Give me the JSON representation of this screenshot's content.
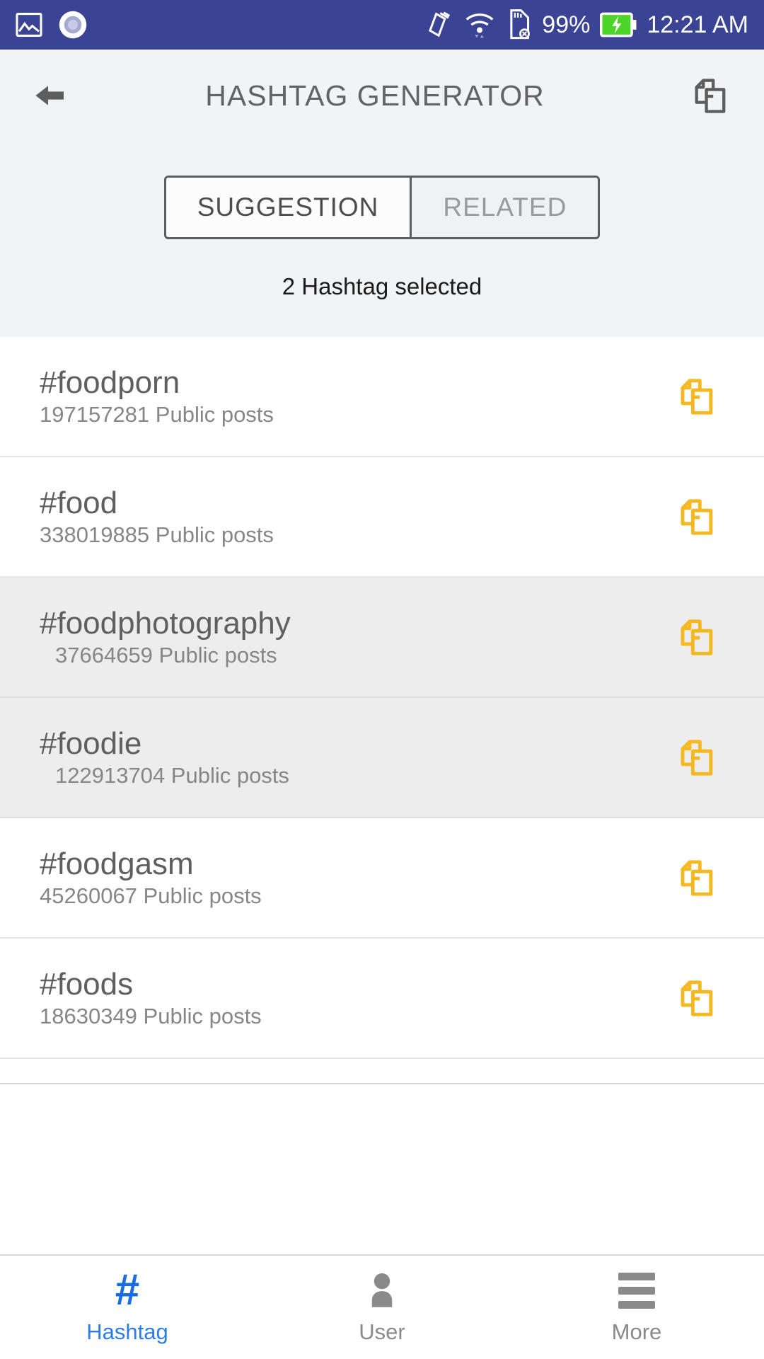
{
  "status_bar": {
    "background_color": "#3b4395",
    "left_icons": [
      "photo-icon",
      "record-circle-icon"
    ],
    "right_icons": [
      "vibrate-icon",
      "wifi-icon",
      "sdcard-off-icon",
      "battery-charging-icon"
    ],
    "battery_percent": "99%",
    "time": "12:21 AM"
  },
  "header": {
    "back_icon": "arrow-back-icon",
    "title": "HASHTAG GENERATOR",
    "copy_icon": "copy-all-icon",
    "title_color": "#636363",
    "background_color": "#f2f3f5"
  },
  "tabs": [
    {
      "label": "SUGGESTION",
      "active": true
    },
    {
      "label": "RELATED",
      "active": false
    }
  ],
  "selected_status": "2 Hashtag selected",
  "list": {
    "copy_icon": "copy-hashtag-icon",
    "copy_icon_color": "#F5B820",
    "selected_row_color": "#ededed",
    "rows": [
      {
        "tag": "#foodporn",
        "posts": "197157281 Public posts",
        "selected": false
      },
      {
        "tag": "#food",
        "posts": "338019885 Public posts",
        "selected": false
      },
      {
        "tag": "#foodphotography",
        "posts": "37664659 Public posts",
        "selected": true
      },
      {
        "tag": "#foodie",
        "posts": "122913704 Public posts",
        "selected": true
      },
      {
        "tag": "#foodgasm",
        "posts": "45260067 Public posts",
        "selected": false
      },
      {
        "tag": "#foods",
        "posts": "18630349 Public posts",
        "selected": false
      }
    ]
  },
  "bottom_nav": {
    "active_color": "#2c7ce4",
    "inactive_color": "#8a8a8a",
    "items": [
      {
        "label": "Hashtag",
        "icon": "hashtag-icon",
        "active": true
      },
      {
        "label": "User",
        "icon": "person-icon",
        "active": false
      },
      {
        "label": "More",
        "icon": "menu-icon",
        "active": false
      }
    ]
  }
}
